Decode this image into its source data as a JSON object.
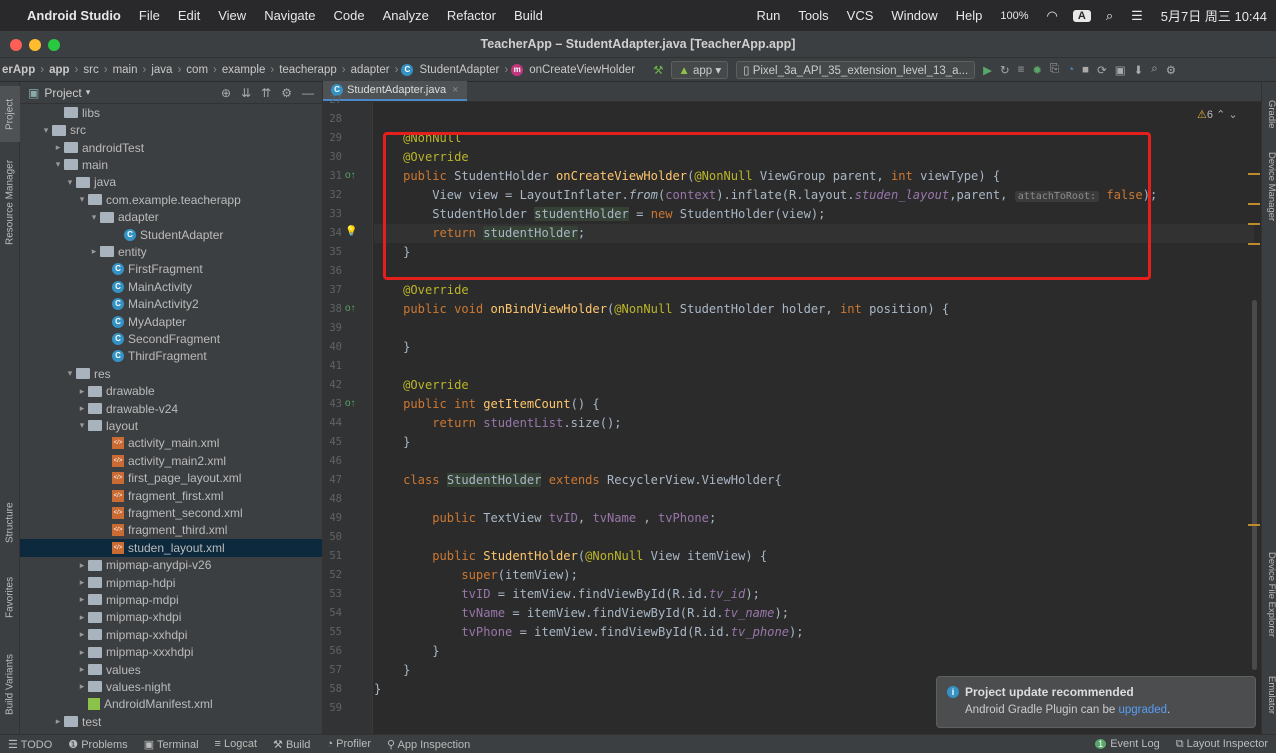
{
  "menubar": {
    "apple": "",
    "app_name": "Android Studio",
    "items": [
      "File",
      "Edit",
      "View",
      "Navigate",
      "Code",
      "Analyze",
      "Refactor",
      "Build",
      "Run",
      "Tools",
      "VCS",
      "Window",
      "Help"
    ],
    "battery": "100%",
    "input_badge": "A",
    "clock": "5月7日 周三 10:44"
  },
  "window": {
    "title": "TeacherApp – StudentAdapter.java [TeacherApp.app]"
  },
  "navbar": {
    "crumbs": [
      "erApp",
      "app",
      "src",
      "main",
      "java",
      "com",
      "example",
      "teacherapp",
      "adapter",
      "StudentAdapter",
      "onCreateViewHolder"
    ],
    "run_config": "app",
    "device": "Pixel_3a_API_35_extension_level_13_a..."
  },
  "left_tabs": {
    "project": "Project",
    "resource_manager": "Resource Manager",
    "structure": "Structure",
    "favorites": "Favorites",
    "build_variants": "Build Variants"
  },
  "right_tabs": {
    "gradle": "Gradle",
    "device_manager": "Device Manager",
    "device_file_explorer": "Device File Explorer",
    "emulator": "Emulator"
  },
  "project": {
    "header": "Project",
    "tree": [
      {
        "label": "libs",
        "type": "folder",
        "depth": 3,
        "arrow": ""
      },
      {
        "label": "src",
        "type": "folder",
        "depth": 2,
        "arrow": "▾"
      },
      {
        "label": "androidTest",
        "type": "folder",
        "depth": 3,
        "arrow": "▸"
      },
      {
        "label": "main",
        "type": "folder",
        "depth": 3,
        "arrow": "▾"
      },
      {
        "label": "java",
        "type": "folder",
        "depth": 4,
        "arrow": "▾"
      },
      {
        "label": "com.example.teacherapp",
        "type": "folder",
        "depth": 5,
        "arrow": "▾"
      },
      {
        "label": "adapter",
        "type": "folder",
        "depth": 6,
        "arrow": "▾"
      },
      {
        "label": "StudentAdapter",
        "type": "class",
        "depth": 8,
        "arrow": ""
      },
      {
        "label": "entity",
        "type": "folder",
        "depth": 6,
        "arrow": "▸"
      },
      {
        "label": "FirstFragment",
        "type": "class",
        "depth": 7,
        "arrow": ""
      },
      {
        "label": "MainActivity",
        "type": "class",
        "depth": 7,
        "arrow": ""
      },
      {
        "label": "MainActivity2",
        "type": "class",
        "depth": 7,
        "arrow": ""
      },
      {
        "label": "MyAdapter",
        "type": "class",
        "depth": 7,
        "arrow": ""
      },
      {
        "label": "SecondFragment",
        "type": "class",
        "depth": 7,
        "arrow": ""
      },
      {
        "label": "ThirdFragment",
        "type": "class",
        "depth": 7,
        "arrow": ""
      },
      {
        "label": "res",
        "type": "folder",
        "depth": 4,
        "arrow": "▾"
      },
      {
        "label": "drawable",
        "type": "folder",
        "depth": 5,
        "arrow": "▸"
      },
      {
        "label": "drawable-v24",
        "type": "folder",
        "depth": 5,
        "arrow": "▸"
      },
      {
        "label": "layout",
        "type": "folder",
        "depth": 5,
        "arrow": "▾"
      },
      {
        "label": "activity_main.xml",
        "type": "xml",
        "depth": 7,
        "arrow": ""
      },
      {
        "label": "activity_main2.xml",
        "type": "xml",
        "depth": 7,
        "arrow": ""
      },
      {
        "label": "first_page_layout.xml",
        "type": "xml",
        "depth": 7,
        "arrow": ""
      },
      {
        "label": "fragment_first.xml",
        "type": "xml",
        "depth": 7,
        "arrow": ""
      },
      {
        "label": "fragment_second.xml",
        "type": "xml",
        "depth": 7,
        "arrow": ""
      },
      {
        "label": "fragment_third.xml",
        "type": "xml",
        "depth": 7,
        "arrow": ""
      },
      {
        "label": "studen_layout.xml",
        "type": "xml",
        "depth": 7,
        "arrow": "",
        "selected": true
      },
      {
        "label": "mipmap-anydpi-v26",
        "type": "folder",
        "depth": 5,
        "arrow": "▸"
      },
      {
        "label": "mipmap-hdpi",
        "type": "folder",
        "depth": 5,
        "arrow": "▸"
      },
      {
        "label": "mipmap-mdpi",
        "type": "folder",
        "depth": 5,
        "arrow": "▸"
      },
      {
        "label": "mipmap-xhdpi",
        "type": "folder",
        "depth": 5,
        "arrow": "▸"
      },
      {
        "label": "mipmap-xxhdpi",
        "type": "folder",
        "depth": 5,
        "arrow": "▸"
      },
      {
        "label": "mipmap-xxxhdpi",
        "type": "folder",
        "depth": 5,
        "arrow": "▸"
      },
      {
        "label": "values",
        "type": "folder",
        "depth": 5,
        "arrow": "▸"
      },
      {
        "label": "values-night",
        "type": "folder",
        "depth": 5,
        "arrow": "▸"
      },
      {
        "label": "AndroidManifest.xml",
        "type": "manifest",
        "depth": 5,
        "arrow": ""
      },
      {
        "label": "test",
        "type": "folder",
        "depth": 3,
        "arrow": "▸"
      }
    ]
  },
  "editor": {
    "tab": "StudentAdapter.java",
    "warning_count": "6",
    "line_numbers": [
      "27",
      "28",
      "29",
      "30",
      "31",
      "32",
      "33",
      "34",
      "35",
      "36",
      "37",
      "38",
      "39",
      "40",
      "41",
      "42",
      "43",
      "44",
      "45",
      "46",
      "47",
      "48",
      "49",
      "50",
      "51",
      "52",
      "53",
      "54",
      "55",
      "56",
      "57",
      "58",
      "59"
    ],
    "lines": [
      "",
      "",
      "    <span class=\"ann\">@NonNull</span>",
      "    <span class=\"ann\">@Override</span>",
      "    <span class=\"kw\">public</span> StudentHolder <span class=\"fn\">onCreateViewHolder</span>(<span class=\"ann\">@NonNull</span> ViewGroup parent, <span class=\"kw\">int</span> viewType) {",
      "        View view = LayoutInflater.<span class=\"it\">from</span>(<span class=\"fld\">context</span>).inflate(R.layout.<span class=\"fld it\">studen_layout</span>,parent, <span class=\"hint\">attachToRoot:</span> <span class=\"kw\">false</span>);",
      "        StudentHolder <span class=\"hl\">studentHolder</span> = <span class=\"kw\">new</span> StudentHolder(view);",
      "        <span class=\"kw\">return</span> <span class=\"hl\">studentHolder</span>;",
      "    }",
      "",
      "    <span class=\"ann\">@Override</span>",
      "    <span class=\"kw\">public void</span> <span class=\"fn\">onBindViewHolder</span>(<span class=\"ann\">@NonNull</span> StudentHolder holder, <span class=\"kw\">int</span> position) {",
      "",
      "    }",
      "",
      "    <span class=\"ann\">@Override</span>",
      "    <span class=\"kw\">public int</span> <span class=\"fn\">getItemCount</span>() {",
      "        <span class=\"kw\">return</span> <span class=\"fld\">studentList</span>.size();",
      "    }",
      "",
      "    <span class=\"kw\">class</span> <span class=\"hl\">StudentHolder</span> <span class=\"kw\">extends</span> RecyclerView.ViewHolder{",
      "",
      "        <span class=\"kw\">public</span> TextView <span class=\"fld\">tvID</span>, <span class=\"fld\">tvName</span> , <span class=\"fld\">tvPhone</span>;",
      "",
      "        <span class=\"kw\">public</span> <span class=\"fn\">StudentHolder</span>(<span class=\"ann\">@NonNull</span> View itemView) {",
      "            <span class=\"kw\">super</span>(itemView);",
      "            <span class=\"fld\">tvID</span> = itemView.findViewById(R.id.<span class=\"fld it\">tv_id</span>);",
      "            <span class=\"fld\">tvName</span> = itemView.findViewById(R.id.<span class=\"fld it\">tv_name</span>);",
      "            <span class=\"fld\">tvPhone</span> = itemView.findViewById(R.id.<span class=\"fld it\">tv_phone</span>);",
      "        }",
      "    }",
      "}",
      ""
    ],
    "current_line_index": 7
  },
  "notification": {
    "title": "Project update recommended",
    "body_prefix": "Android Gradle Plugin can be ",
    "link": "upgraded",
    "body_suffix": "."
  },
  "bottombar": {
    "left": [
      "TODO",
      "Problems",
      "Terminal",
      "Logcat",
      "Build",
      "Profiler",
      "App Inspection"
    ],
    "right": [
      "Event Log",
      "Layout Inspector"
    ],
    "event_badge": "1"
  },
  "colors": {
    "highlight_box": "#e5201c",
    "accent": "#4a88c7"
  }
}
